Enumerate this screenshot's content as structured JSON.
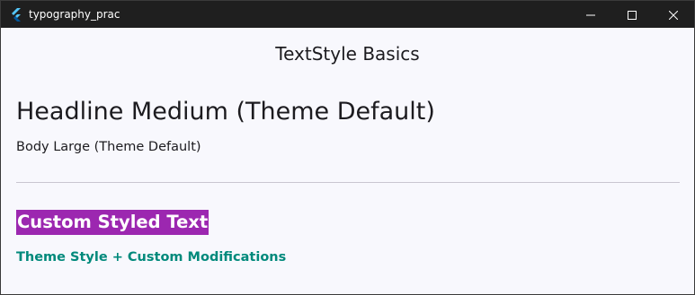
{
  "window": {
    "title": "typography_prac",
    "controls": {
      "minimize": "minimize-icon",
      "maximize": "maximize-icon",
      "close": "close-icon"
    }
  },
  "appbar": {
    "title": "TextStyle Basics"
  },
  "main": {
    "headline": "Headline Medium (Theme Default)",
    "body": "Body Large (Theme Default)",
    "custom_text": "Custom Styled Text",
    "theme_modified": "Theme Style + Custom Modifications"
  },
  "colors": {
    "custom_text_bg": "#9c27b0",
    "custom_text_fg": "#ffffff",
    "theme_modified_fg": "#00897b",
    "background": "#f8f8fd"
  }
}
